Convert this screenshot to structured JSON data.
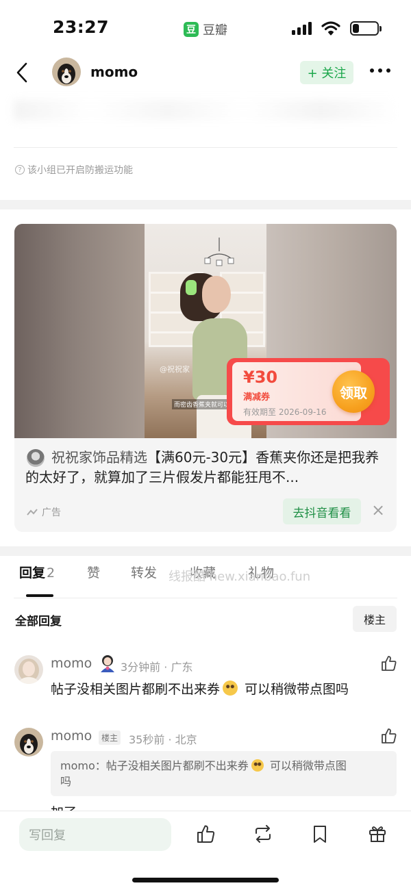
{
  "status_bar": {
    "time": "23:27",
    "app_logo": "豆",
    "app_name": "豆瓣",
    "battery_level": 0.25
  },
  "nav": {
    "user_name": "momo",
    "follow_label": "+ 关注"
  },
  "notice": {
    "icon": "?",
    "text": "该小组已开启防搬运功能"
  },
  "ad": {
    "watermark": "@祝祝家",
    "caption": "而密齿香蕉夹就可以满",
    "coupon_amount": "¥30",
    "coupon_type": "满减券",
    "coupon_expiry": "有效期至 2026-09-16",
    "coupon_button": "领取",
    "brand": "祝祝家饰品精选",
    "title": "【满60元-30元】香蕉夹你还是把我养的太好了，就算加了三片假发片都能狂甩不...",
    "label": "广告",
    "cta": "去抖音看看",
    "close": "×"
  },
  "tabs": [
    {
      "label": "回复",
      "count": "2"
    },
    {
      "label": "赞"
    },
    {
      "label": "转发"
    },
    {
      "label": "收藏"
    },
    {
      "label": "礼物"
    }
  ],
  "watermark_text": "线报酷 new.xianbao.fun",
  "replies_section": {
    "title": "全部回复",
    "owner_filter": "楼主"
  },
  "comments": [
    {
      "name": "momo",
      "meta": "3分钟前 · 广东",
      "text_before": "帖子没相关图片都刷不出来券",
      "text_after": " 可以稍微带点图吗"
    },
    {
      "name": "momo",
      "badge": "楼主",
      "meta": "35秒前 · 北京",
      "quote_prefix": "momo：",
      "quote_before": "帖子没相关图片都刷不出来券",
      "quote_after": " 可以稍微带点图",
      "quote_wrap": "吗",
      "text": "加了"
    }
  ],
  "bottom_bar": {
    "reply_placeholder": "写回复"
  }
}
